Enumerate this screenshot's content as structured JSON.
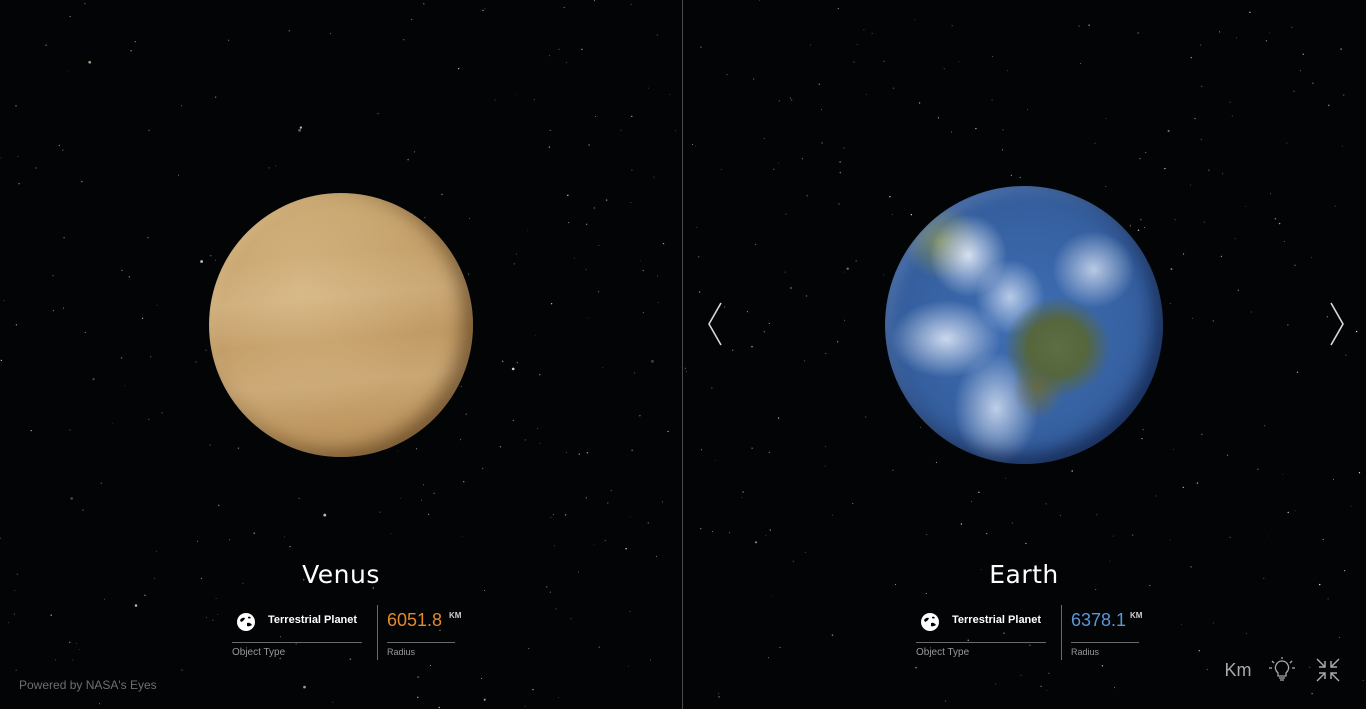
{
  "left_panel": {
    "name": "Venus",
    "object_type": "Terrestrial Planet",
    "object_type_caption": "Object Type",
    "radius_value": "6051.8",
    "radius_unit": "KM",
    "radius_caption": "Radius",
    "radius_color": "#e3892a",
    "planet_icon": "venus-globe"
  },
  "right_panel": {
    "name": "Earth",
    "object_type": "Terrestrial Planet",
    "object_type_caption": "Object Type",
    "radius_value": "6378.1",
    "radius_unit": "KM",
    "radius_caption": "Radius",
    "radius_color": "#5a96d8",
    "planet_icon": "earth-globe"
  },
  "navigation": {
    "prev_icon": "chevron-left-icon",
    "next_icon": "chevron-right-icon"
  },
  "footer": {
    "powered_by": "Powered by NASA's Eyes"
  },
  "toolbar": {
    "units_label": "Km",
    "light_icon": "lightbulb-icon",
    "collapse_icon": "collapse-arrows-icon"
  },
  "colors": {
    "background": "#030405",
    "divider": "#4a4a4a",
    "venus_accent": "#e3892a",
    "earth_accent": "#5a96d8"
  }
}
